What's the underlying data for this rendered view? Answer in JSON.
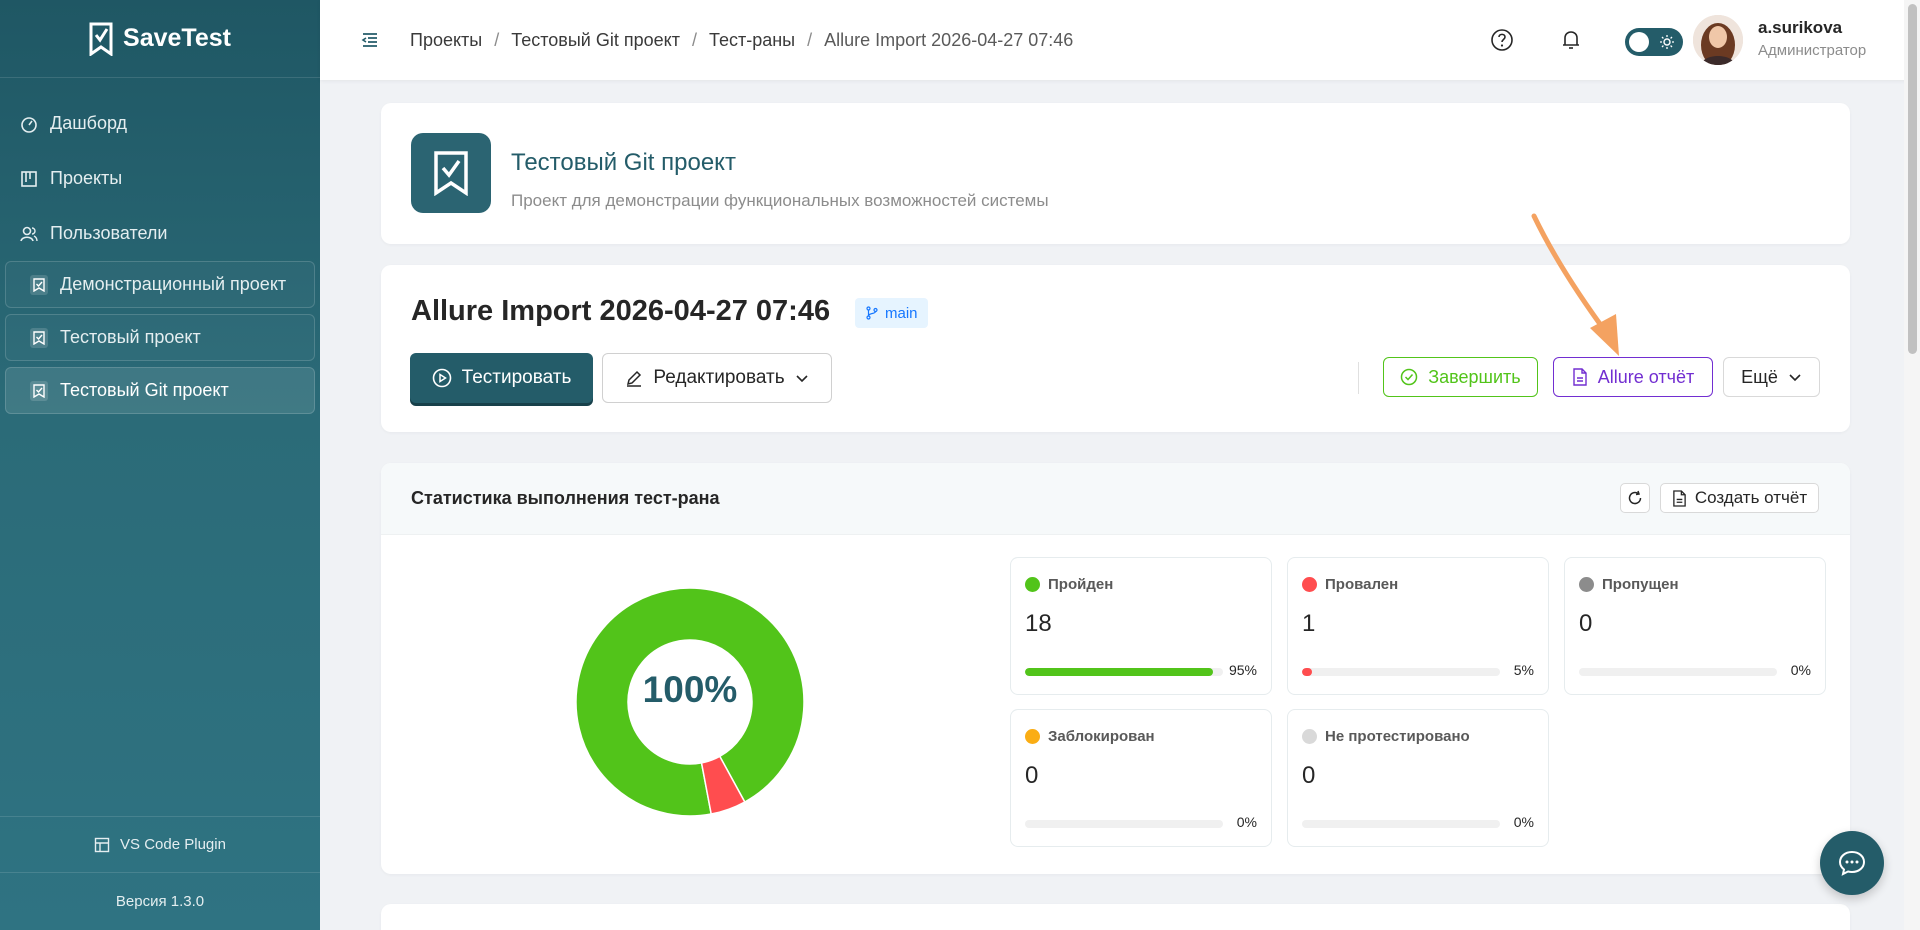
{
  "app": {
    "name": "SaveTest"
  },
  "sidebar": {
    "nav": [
      {
        "label": "Дашборд",
        "icon": "dashboard-icon"
      },
      {
        "label": "Проекты",
        "icon": "projects-icon"
      },
      {
        "label": "Пользователи",
        "icon": "users-icon"
      }
    ],
    "projects": [
      {
        "label": "Демонстрационный проект"
      },
      {
        "label": "Тестовый проект"
      },
      {
        "label": "Тестовый Git проект",
        "active": true
      }
    ],
    "plugin": "VS Code Plugin",
    "version": "Версия 1.3.0"
  },
  "header": {
    "breadcrumb": [
      "Проекты",
      "Тестовый Git проект",
      "Тест-раны",
      "Allure Import 2026-04-27 07:46"
    ],
    "user": {
      "name": "a.surikova",
      "role": "Администратор"
    }
  },
  "project": {
    "title": "Тестовый Git проект",
    "description": "Проект для демонстрации функциональных возможностей системы"
  },
  "run": {
    "title": "Allure Import 2026-04-27 07:46",
    "branch": "main",
    "test_button": "Тестировать",
    "edit_button": "Редактировать",
    "finish_button": "Завершить",
    "allure_button": "Allure отчёт",
    "more_button": "Ещё"
  },
  "stats": {
    "title": "Статистика выполнения тест-рана",
    "report_button": "Создать отчёт",
    "donut_label": "100%",
    "items": [
      {
        "name": "Пройден",
        "count": "18",
        "percent": "95%",
        "fraction": 0.95,
        "color": "#52c41a"
      },
      {
        "name": "Провален",
        "count": "1",
        "percent": "5%",
        "fraction": 0.05,
        "color": "#ff4d4f"
      },
      {
        "name": "Пропущен",
        "count": "0",
        "percent": "0%",
        "fraction": 0,
        "color": "#8c8c8c"
      },
      {
        "name": "Заблокирован",
        "count": "0",
        "percent": "0%",
        "fraction": 0,
        "color": "#faad14"
      },
      {
        "name": "Не протестировано",
        "count": "0",
        "percent": "0%",
        "fraction": 0,
        "color": "#d9d9d9"
      }
    ]
  },
  "colors": {
    "brand": "#245c69",
    "passed": "#52c41a",
    "failed": "#ff4d4f",
    "allure": "#722ed1",
    "arrow": "#f4a261"
  }
}
